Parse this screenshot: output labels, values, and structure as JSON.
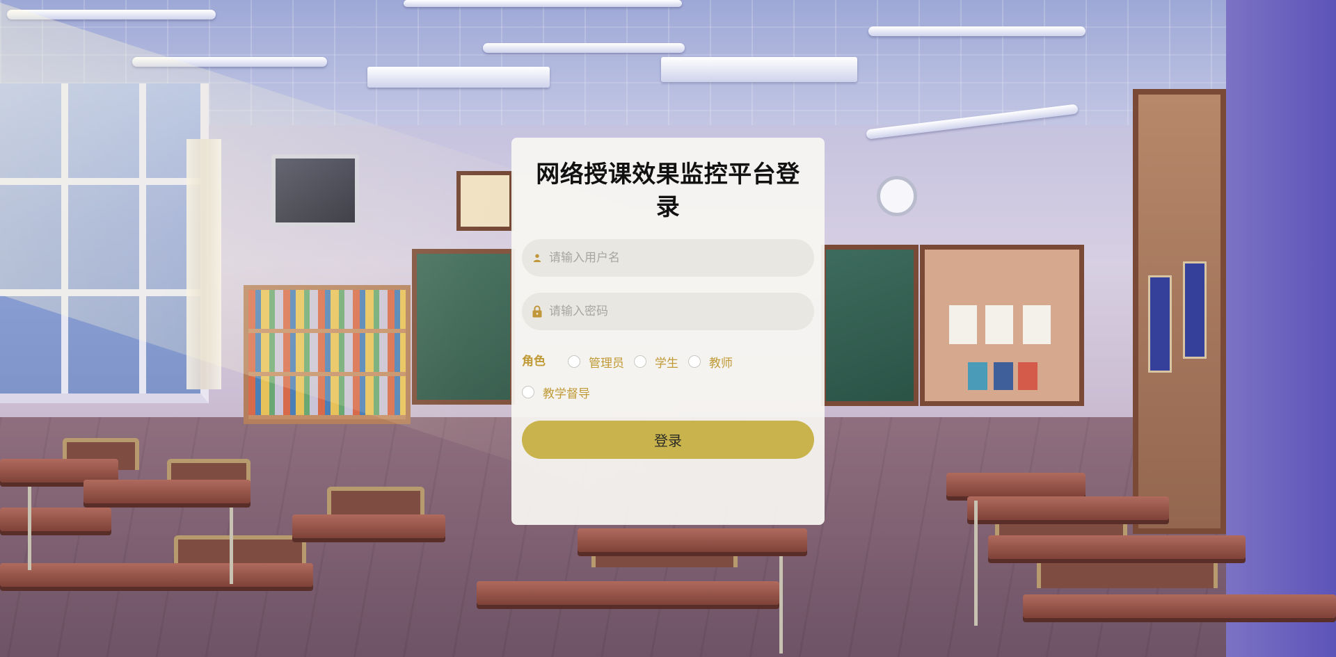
{
  "login": {
    "title": "网络授课效果监控平台登录",
    "username": {
      "placeholder": "请输入用户名",
      "icon": "user-icon",
      "value": ""
    },
    "password": {
      "placeholder": "请输入密码",
      "icon": "lock-icon",
      "value": ""
    },
    "role_label": "角色",
    "roles": [
      {
        "label": "管理员",
        "selected": false
      },
      {
        "label": "学生",
        "selected": false
      },
      {
        "label": "教师",
        "selected": false
      },
      {
        "label": "教学督导",
        "selected": false
      }
    ],
    "submit_label": "登录"
  },
  "colors": {
    "accent": "#c9b34c",
    "role_text": "#c09a36",
    "icon": "#c0963a",
    "card_bg": "#f7f6f2"
  }
}
